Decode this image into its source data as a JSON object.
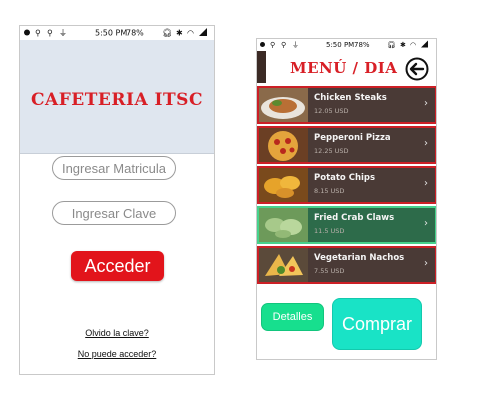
{
  "left_screen": {
    "status": {
      "time": "5:50 PM",
      "battery": "78%"
    },
    "app_title": "CAFETERIA ITSC",
    "matricula_placeholder": "Ingresar Matricula",
    "clave_placeholder": "Ingresar Clave",
    "login_button": "Acceder",
    "forgot_link": "Olvido la clave?",
    "cannot_access_link": "No puede acceder?"
  },
  "right_screen": {
    "status": {
      "time": "5:50 PM",
      "battery": "78%"
    },
    "title": "MENÚ / DIA",
    "items": [
      {
        "name": "Chicken Steaks",
        "price": "12.05 USD",
        "selected": false
      },
      {
        "name": "Pepperoni Pizza",
        "price": "12.25 USD",
        "selected": false
      },
      {
        "name": "Potato Chips",
        "price": "8.15 USD",
        "selected": false
      },
      {
        "name": "Fried Crab Claws",
        "price": "11.5 USD",
        "selected": true
      },
      {
        "name": "Vegetarian Nachos",
        "price": "7.55 USD",
        "selected": false
      }
    ],
    "details_button": "Detalles",
    "buy_button": "Comprar"
  },
  "colors": {
    "brand_red": "#d81f26",
    "header_bg": "#dfe6ef",
    "login_button": "#e2141b",
    "menu_item_bg": "#4a3a36",
    "menu_item_border": "#cc1f26",
    "selected_item_bg": "#2d6b4a",
    "selected_item_border": "#47d18c",
    "details_button": "#17df8e",
    "buy_button": "#19e3c6"
  }
}
